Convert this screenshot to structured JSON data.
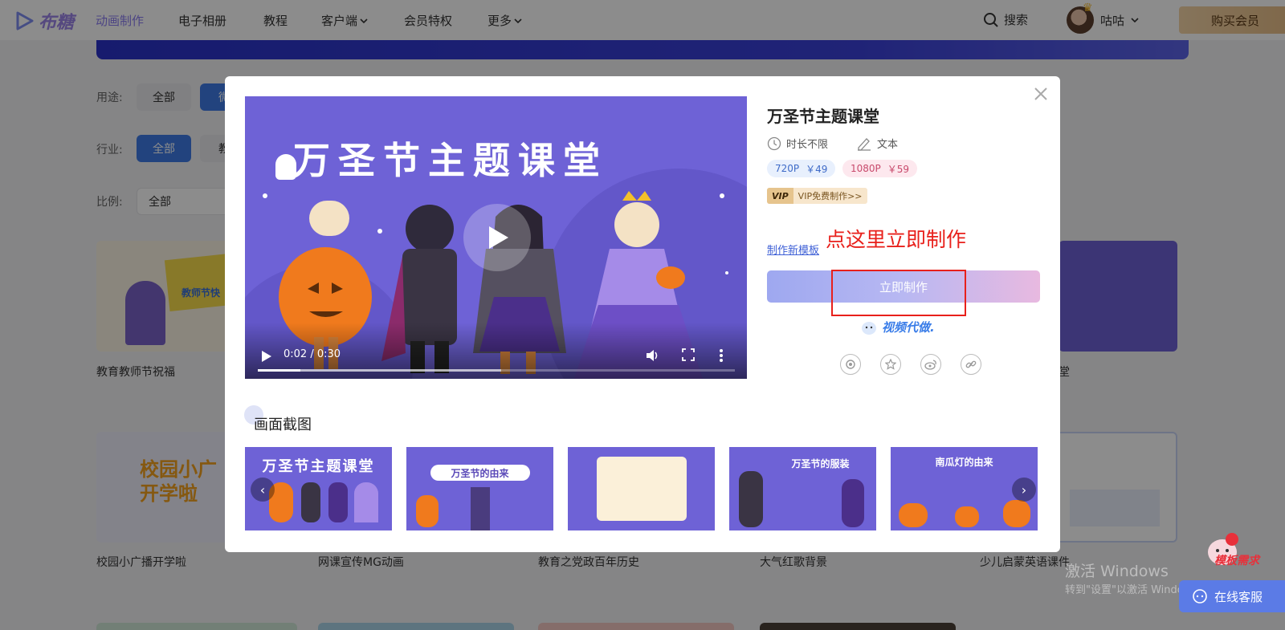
{
  "nav": {
    "logo_text": "布糖",
    "items": [
      {
        "label": "动画制作"
      },
      {
        "label": "电子相册"
      },
      {
        "label": "教程"
      },
      {
        "label": "客户端"
      },
      {
        "label": "会员特权"
      },
      {
        "label": "更多"
      }
    ],
    "search_label": "搜索",
    "username": "咕咕",
    "buy_label": "购买会员"
  },
  "filters": {
    "use_label": "用途:",
    "use_all": "全部",
    "use_second": "微",
    "industry_label": "行业:",
    "industry_all": "全部",
    "industry_second": "教",
    "ratio_label": "比例:",
    "ratio_value": "全部"
  },
  "cards": {
    "row1": [
      {
        "caption": "教育教师节祝福",
        "badge": "教师节快"
      },
      {
        "caption": "堂",
        "badge": ""
      }
    ],
    "row2": [
      {
        "caption": "校园小广播开学啦",
        "badge": "校园小广 开学啦"
      },
      {
        "caption": "网课宣传MG动画"
      },
      {
        "caption": "教育之党政百年历史"
      },
      {
        "caption": "大气红歌背景"
      },
      {
        "caption": "少儿启蒙英语课件"
      }
    ]
  },
  "modal": {
    "title": "万圣节主题课堂",
    "video_title": "万圣节主题课堂",
    "duration": "时长不限",
    "type": "文本",
    "price_720": {
      "res": "720P",
      "price": "￥49"
    },
    "price_1080": {
      "res": "1080P",
      "price": "￥59"
    },
    "vip_tag": "VIP",
    "vip_text": "VIP免费制作>>",
    "new_template": "制作新模板",
    "make_now": "立即制作",
    "annotation": "点这里立即制作",
    "video_proxy": "视频代做.",
    "player": {
      "time": "0:02 / 0:30",
      "progress": 0.09,
      "buffered": 0.51
    },
    "screenshots_heading": "画面截图",
    "thumbnails": [
      {
        "text": "万圣节主题课堂"
      },
      {
        "text": "万圣节的由来"
      },
      {
        "text": ""
      },
      {
        "text": "万圣节的服装"
      },
      {
        "text": "南瓜灯的由来"
      }
    ]
  },
  "bottom": {
    "windows_mark": "激活 Windows",
    "windows_sub": "转到\"设置\"以激活 Windows。",
    "template_request": "模板需求",
    "online_service": "在线客服"
  },
  "colors": {
    "accent": "#3f7be6",
    "purple": "#6e62d6",
    "annotation_red": "#e8201b",
    "gold": "#e7bd86"
  }
}
